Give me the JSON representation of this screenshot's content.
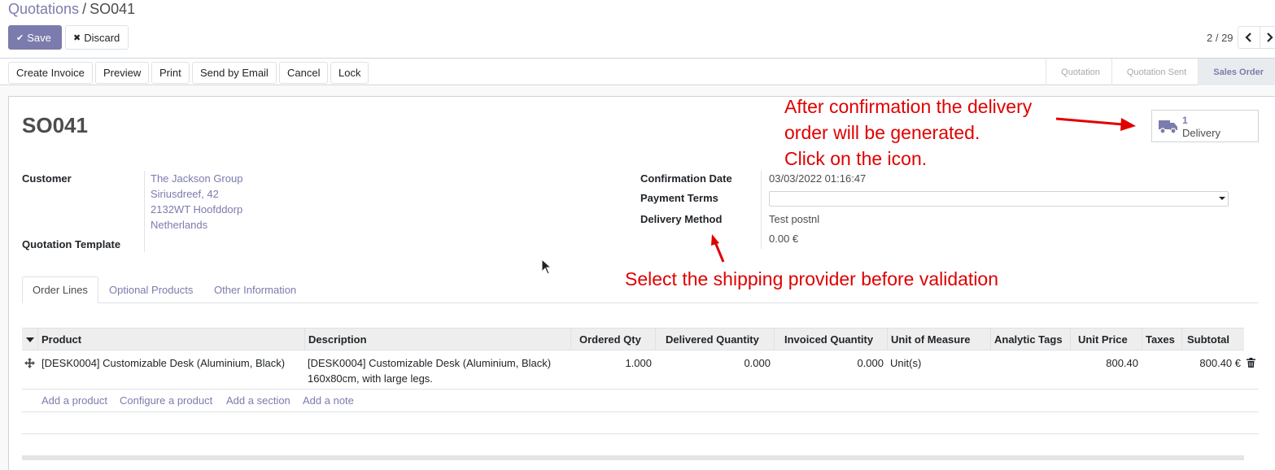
{
  "breadcrumb": {
    "parent": "Quotations",
    "separator": "/",
    "current": "SO041"
  },
  "toolbar": {
    "save_label": "Save",
    "discard_label": "Discard"
  },
  "pager": {
    "value": "2 / 29"
  },
  "actions": [
    "Create Invoice",
    "Preview",
    "Print",
    "Send by Email",
    "Cancel",
    "Lock"
  ],
  "stages": [
    {
      "label": "Quotation",
      "active": false
    },
    {
      "label": "Quotation Sent",
      "active": false
    },
    {
      "label": "Sales Order",
      "active": true
    }
  ],
  "record": {
    "name": "SO041",
    "delivery_button": {
      "count": "1",
      "label": "Delivery"
    },
    "customer_label": "Customer",
    "customer_lines": [
      "The Jackson Group",
      "Siriusdreef, 42",
      "2132WT Hoofddorp",
      "Netherlands"
    ],
    "template_label": "Quotation Template",
    "confirmation_label": "Confirmation Date",
    "confirmation_value": "03/03/2022 01:16:47",
    "payment_terms_label": "Payment Terms",
    "payment_terms_value": "",
    "delivery_method_label": "Delivery Method",
    "delivery_method_value": "Test postnl",
    "delivery_price": "0.00 €"
  },
  "annotations": {
    "delivery_note_lines": [
      "After confirmation the delivery",
      "order will be generated.",
      "Click on the icon."
    ],
    "shipping_note": "Select the shipping provider before validation"
  },
  "tabs": [
    "Order Lines",
    "Optional Products",
    "Other Information"
  ],
  "table": {
    "headers": [
      "Product",
      "Description",
      "Ordered Qty",
      "Delivered Quantity",
      "Invoiced Quantity",
      "Unit of Measure",
      "Analytic Tags",
      "Unit Price",
      "Taxes",
      "Subtotal"
    ],
    "rows": [
      {
        "product": "[DESK0004] Customizable Desk (Aluminium, Black)",
        "description_lines": [
          "[DESK0004] Customizable Desk (Aluminium, Black)",
          "160x80cm, with large legs."
        ],
        "ordered_qty": "1.000",
        "delivered_qty": "0.000",
        "invoiced_qty": "0.000",
        "uom": "Unit(s)",
        "analytic_tags": "",
        "unit_price": "800.40",
        "taxes": "",
        "subtotal": "800.40 €"
      }
    ],
    "add_links": [
      "Add a product",
      "Configure a product",
      "Add a section",
      "Add a note"
    ]
  },
  "colors": {
    "brand": "#7c7bad",
    "annotation": "#e00000"
  },
  "icons": [
    "check-icon",
    "close-icon",
    "chevron-left-icon",
    "chevron-right-icon",
    "truck-icon",
    "drag-handle-icon",
    "trash-icon",
    "sort-caret-icon",
    "mouse-pointer-icon"
  ]
}
